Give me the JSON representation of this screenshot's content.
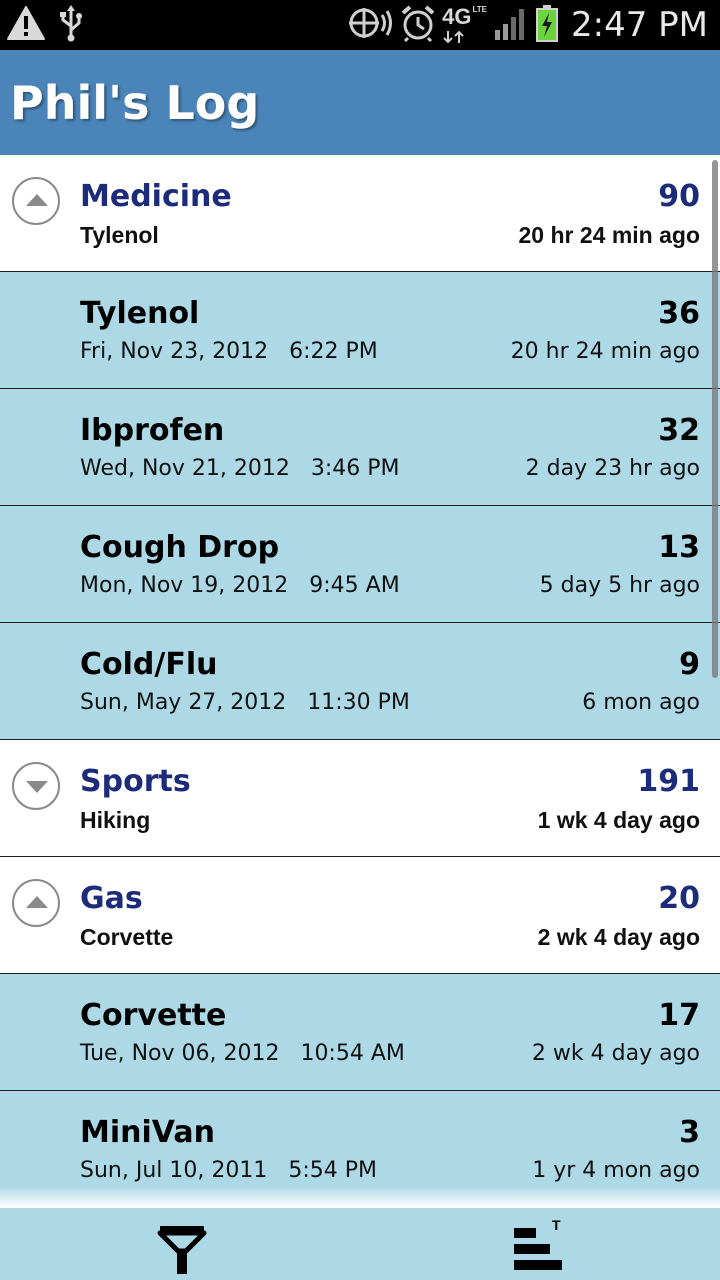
{
  "status_bar": {
    "time": "2:47 PM",
    "network": "4G",
    "network_sub": "LTE",
    "icons": [
      "warning-icon",
      "usb-icon",
      "rotate-icon",
      "alarm-icon",
      "network-4g-lte-icon",
      "signal-icon",
      "battery-charging-icon"
    ]
  },
  "header": {
    "title": "Phil's Log"
  },
  "list": [
    {
      "kind": "group",
      "expanded": true,
      "title": "Medicine",
      "count": "90",
      "subtitle": "Tylenol",
      "ago": "20 hr 24 min ago"
    },
    {
      "kind": "item",
      "title": "Tylenol",
      "count": "36",
      "subtitle": "Fri, Nov 23, 2012   6:22 PM",
      "ago": "20 hr 24 min ago"
    },
    {
      "kind": "item",
      "title": "Ibprofen",
      "count": "32",
      "subtitle": "Wed, Nov 21, 2012   3:46 PM",
      "ago": "2 day 23 hr ago"
    },
    {
      "kind": "item",
      "title": "Cough Drop",
      "count": "13",
      "subtitle": "Mon, Nov 19, 2012   9:45 AM",
      "ago": "5 day 5 hr ago"
    },
    {
      "kind": "item",
      "title": "Cold/Flu",
      "count": "9",
      "subtitle": "Sun, May 27, 2012   11:30 PM",
      "ago": "6 mon ago"
    },
    {
      "kind": "group",
      "expanded": false,
      "title": "Sports",
      "count": "191",
      "subtitle": "Hiking",
      "ago": "1 wk 4 day ago"
    },
    {
      "kind": "group",
      "expanded": true,
      "title": "Gas",
      "count": "20",
      "subtitle": "Corvette",
      "ago": "2 wk 4 day ago"
    },
    {
      "kind": "item",
      "title": "Corvette",
      "count": "17",
      "subtitle": "Tue, Nov 06, 2012   10:54 AM",
      "ago": "2 wk 4 day ago"
    },
    {
      "kind": "item",
      "title": "MiniVan",
      "count": "3",
      "subtitle": "Sun, Jul 10, 2011   5:54 PM",
      "ago": "1 yr 4 mon ago"
    }
  ],
  "bottom_bar": {
    "filter_icon": "filter-icon",
    "sort_icon": "sort-icon",
    "sort_badge": "T"
  },
  "colors": {
    "header_bg": "#4a84b9",
    "child_row_bg": "#add8e6",
    "group_text": "#1c2b7a"
  }
}
